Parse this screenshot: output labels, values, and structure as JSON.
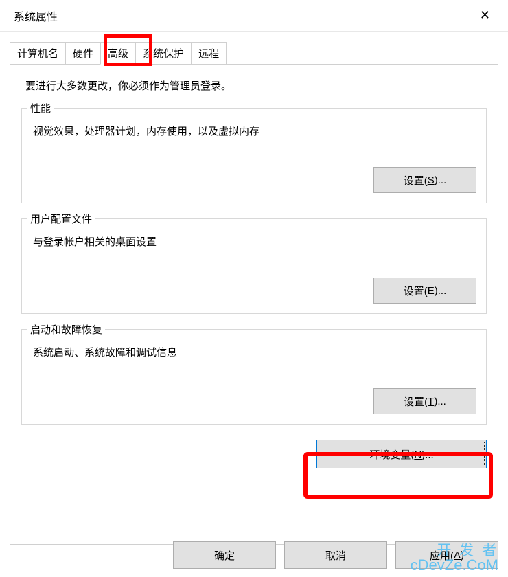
{
  "window": {
    "title": "系统属性",
    "close_glyph": "✕"
  },
  "tabs": {
    "items": [
      {
        "label": "计算机名"
      },
      {
        "label": "硬件"
      },
      {
        "label": "高级",
        "active": true
      },
      {
        "label": "系统保护"
      },
      {
        "label": "远程"
      }
    ]
  },
  "intro": "要进行大多数更改，你必须作为管理员登录。",
  "groups": {
    "performance": {
      "legend": "性能",
      "desc": "视觉效果，处理器计划，内存使用，以及虚拟内存",
      "button": "设置(S)..."
    },
    "profiles": {
      "legend": "用户配置文件",
      "desc": "与登录帐户相关的桌面设置",
      "button": "设置(E)..."
    },
    "startup": {
      "legend": "启动和故障恢复",
      "desc": "系统启动、系统故障和调试信息",
      "button": "设置(T)..."
    }
  },
  "env_button": "环境变量(N)...",
  "bottom": {
    "ok": "确定",
    "cancel": "取消",
    "apply": "应用(A)"
  },
  "watermark": {
    "line1": "开 发 者",
    "line2": "cDevZe.CoM"
  },
  "annotations": {
    "highlighted_tab": "高级",
    "highlighted_button": "环境变量(N)..."
  }
}
